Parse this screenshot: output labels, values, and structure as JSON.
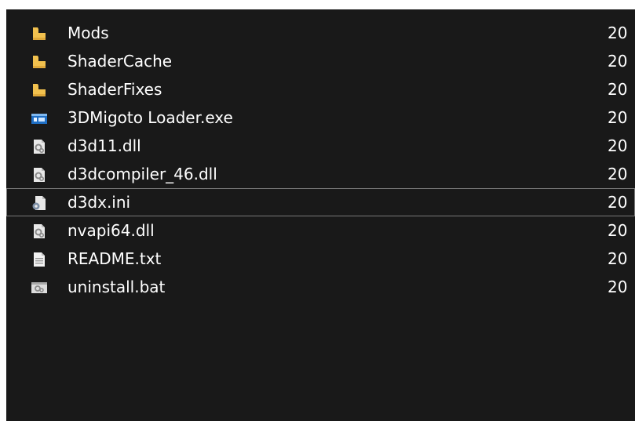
{
  "files": [
    {
      "name": "Mods",
      "icon": "folder-icon",
      "date": "20",
      "selected": false
    },
    {
      "name": "ShaderCache",
      "icon": "folder-icon",
      "date": "20",
      "selected": false
    },
    {
      "name": "ShaderFixes",
      "icon": "folder-icon",
      "date": "20",
      "selected": false
    },
    {
      "name": "3DMigoto Loader.exe",
      "icon": "application-icon",
      "date": "20",
      "selected": false
    },
    {
      "name": "d3d11.dll",
      "icon": "dll-icon",
      "date": "20",
      "selected": false
    },
    {
      "name": "d3dcompiler_46.dll",
      "icon": "dll-icon",
      "date": "20",
      "selected": false
    },
    {
      "name": "d3dx.ini",
      "icon": "settings-file-icon",
      "date": "20",
      "selected": true
    },
    {
      "name": "nvapi64.dll",
      "icon": "dll-icon",
      "date": "20",
      "selected": false
    },
    {
      "name": "README.txt",
      "icon": "text-file-icon",
      "date": "20",
      "selected": false
    },
    {
      "name": "uninstall.bat",
      "icon": "batch-file-icon",
      "date": "20",
      "selected": false
    }
  ],
  "colors": {
    "background": "#191919",
    "text": "#ffffff",
    "folder": "#f2c14e",
    "selection_border": "#777777"
  }
}
